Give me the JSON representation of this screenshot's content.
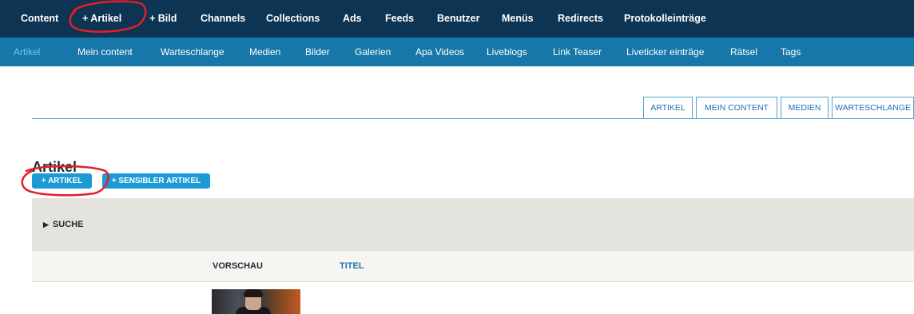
{
  "colors": {
    "topbar_bg": "#0e3453",
    "subbar_bg": "#1777a8",
    "active_subnav": "#5fd0ff",
    "button_bg": "#1b9ad6",
    "tab_text": "#1a72b0",
    "annotation": "#e21f26"
  },
  "top_nav": [
    {
      "label": "Content"
    },
    {
      "label": "+ Artikel"
    },
    {
      "label": "+ Bild"
    },
    {
      "label": "Channels"
    },
    {
      "label": "Collections"
    },
    {
      "label": "Ads"
    },
    {
      "label": "Feeds"
    },
    {
      "label": "Benutzer"
    },
    {
      "label": "Menüs"
    },
    {
      "label": "Redirects"
    },
    {
      "label": "Protokolleinträge"
    }
  ],
  "sub_nav": [
    {
      "label": "Artikel",
      "active": true
    },
    {
      "label": "Mein content"
    },
    {
      "label": "Warteschlange"
    },
    {
      "label": "Medien"
    },
    {
      "label": "Bilder"
    },
    {
      "label": "Galerien"
    },
    {
      "label": "Apa Videos"
    },
    {
      "label": "Liveblogs"
    },
    {
      "label": "Link Teaser"
    },
    {
      "label": "Liveticker einträge"
    },
    {
      "label": "Rätsel"
    },
    {
      "label": "Tags"
    }
  ],
  "tabs": [
    {
      "label": "ARTIKEL",
      "active": true
    },
    {
      "label": "MEIN CONTENT"
    },
    {
      "label": "MEDIEN"
    },
    {
      "label": "WARTESCHLANGE"
    }
  ],
  "page": {
    "title": "Artikel"
  },
  "actions": {
    "add_article": "+ ARTIKEL",
    "add_sensitive_article": "+ SENSIBLER ARTIKEL"
  },
  "search": {
    "toggle_icon": "triangle-right",
    "label": "SUCHE"
  },
  "table": {
    "columns": [
      {
        "label": "VORSCHAU",
        "sortable": false
      },
      {
        "label": "TITEL",
        "sortable": true
      }
    ]
  }
}
